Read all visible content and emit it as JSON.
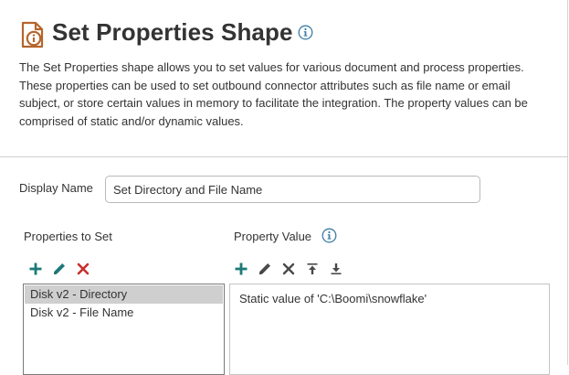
{
  "header": {
    "title": "Set Properties Shape",
    "description": "The Set Properties shape allows you to set values for various document and process properties. These properties can be used to set outbound connector attributes such as file name or email subject, or store certain values in memory to facilitate the integration. The property values can be comprised of static and/or dynamic values."
  },
  "form": {
    "display_name_label": "Display Name",
    "display_name_value": "Set Directory and File Name"
  },
  "properties_panel": {
    "label": "Properties to Set",
    "items": [
      {
        "label": "Disk v2 - Directory",
        "selected": true
      },
      {
        "label": "Disk v2 - File Name",
        "selected": false
      }
    ]
  },
  "value_panel": {
    "label": "Property Value",
    "items": [
      {
        "label": "Static value of 'C:\\Boomi\\snowflake'"
      }
    ]
  },
  "icons": {
    "shape": "set-properties-shape-icon",
    "info": "info-icon",
    "add": "plus-icon",
    "edit": "pencil-icon",
    "delete": "x-icon",
    "move_up": "move-up-icon",
    "move_down": "move-down-icon"
  },
  "colors": {
    "shape_icon": "#b5652b",
    "info_icon": "#3b7ea5",
    "add": "#1e7a78",
    "edit": "#1e7a78",
    "delete_active": "#c8302c",
    "delete_neutral": "#4a4a4a",
    "selected_row": "#cfcfcf"
  }
}
